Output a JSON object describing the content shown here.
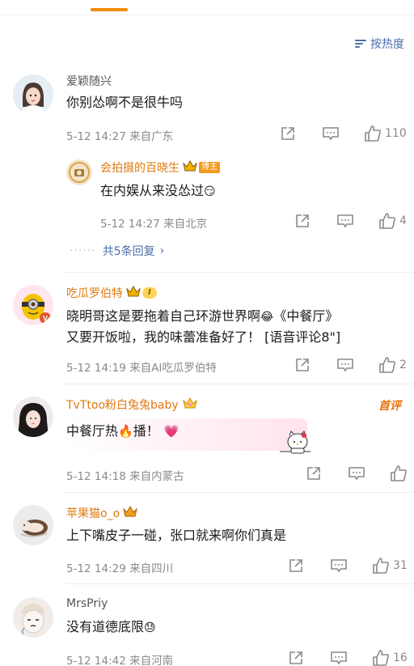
{
  "sort": {
    "label": "按热度"
  },
  "comments": [
    {
      "user": "爱颖随兴",
      "text": "你别怂啊不是很牛吗",
      "meta": "5-12 14:27 来自广东",
      "likes": "110",
      "reply": {
        "user": "会拍摄的百晓生",
        "badge": "博主",
        "text": "在内娱从来没怂过",
        "emoji": "😏",
        "meta": "5-12 14:27 来自北京",
        "likes": "4"
      },
      "replies_link": "共5条回复"
    },
    {
      "user": "吃瓜罗伯特",
      "level": "I",
      "text_line1": "晓明哥这是要拖着自己环游世界啊",
      "emoji": "😂",
      "text_line1b": "《中餐厅》",
      "text_line2": "又要开饭啦，我的味蕾准备好了！ [语音评论8\"]",
      "meta": "5-12 14:19 来自AI吃瓜罗伯特",
      "likes": "2"
    },
    {
      "user": "TvTtoo粉白兔兔baby",
      "first_badge": "首评",
      "text_a": "中餐厅热",
      "emoji_fire": "🔥",
      "text_b": "播！",
      "emoji_heart": "💗",
      "meta": "5-12 14:18 来自内蒙古",
      "likes": ""
    },
    {
      "user": "苹果猫o_o",
      "text": "上下嘴皮子一碰，张口就来啊你们真是",
      "meta": "5-12 14:29 来自四川",
      "likes": "31"
    },
    {
      "user": "MrsPriy",
      "text": "没有道德底限",
      "emoji": "😓",
      "meta": "5-12 14:42 来自河南",
      "likes": "16"
    }
  ]
}
